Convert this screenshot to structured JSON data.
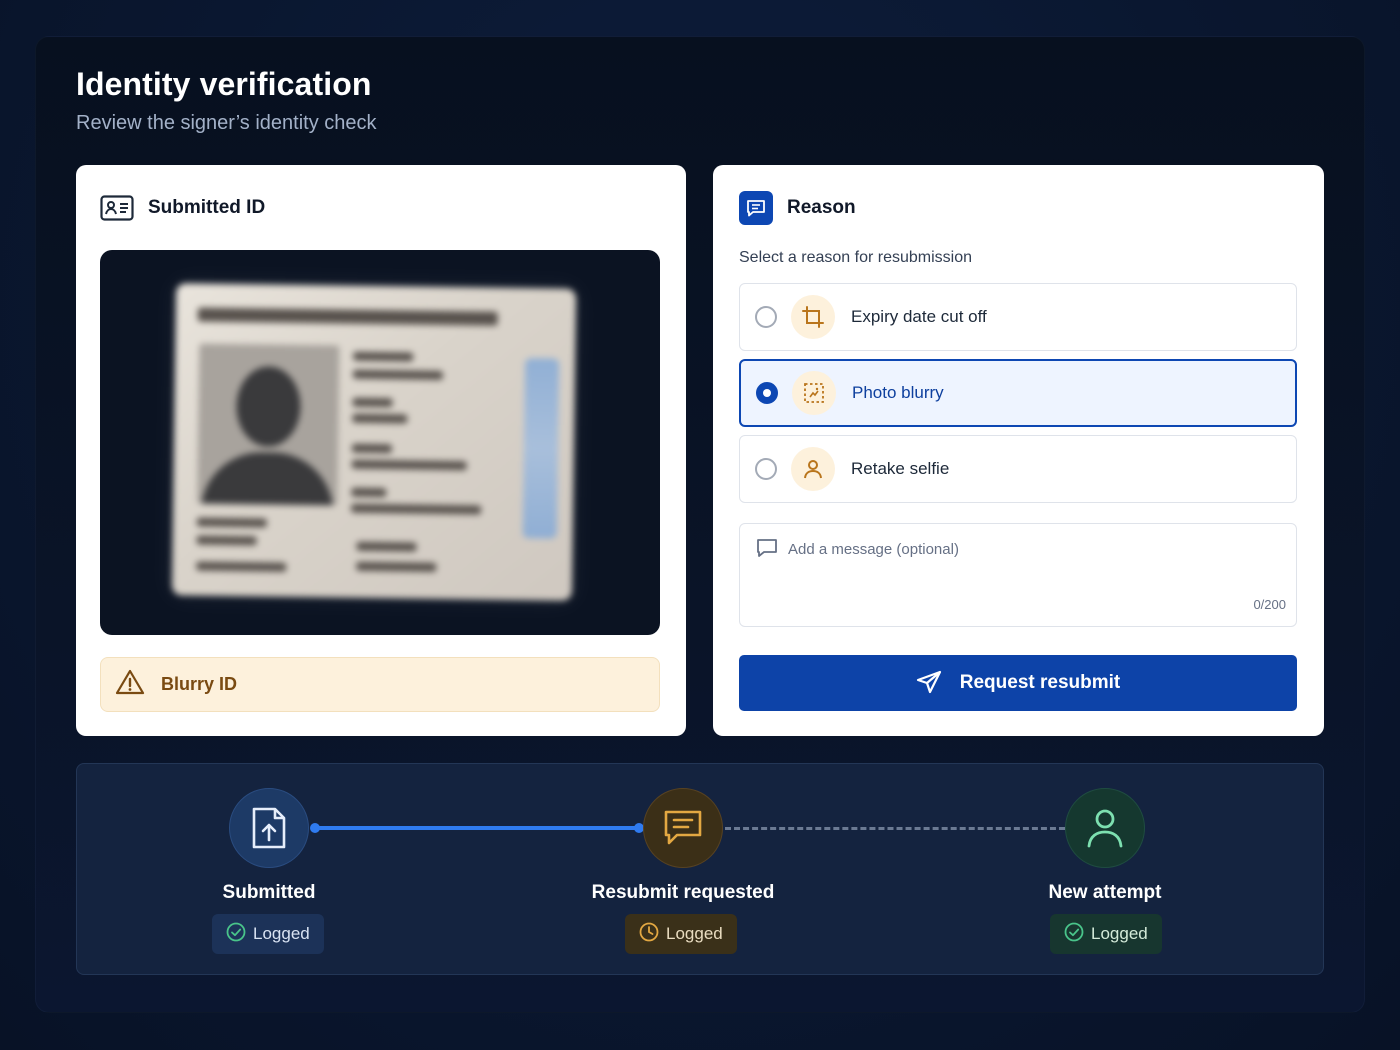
{
  "header": {
    "title": "Identity verification",
    "subtitle": "Review the signer’s identity check"
  },
  "submitted_id": {
    "title": "Submitted ID",
    "warning": "Blurry ID"
  },
  "reason": {
    "title": "Reason",
    "prompt": "Select a reason for resubmission",
    "options": [
      {
        "label": "Expiry date cut off",
        "icon": "crop-icon",
        "selected": false
      },
      {
        "label": "Photo blurry",
        "icon": "focus-icon",
        "selected": true
      },
      {
        "label": "Retake selfie",
        "icon": "person-icon",
        "selected": false
      }
    ],
    "message_placeholder": "Add a message (optional)",
    "message_counter": "0/200",
    "submit_label": "Request resubmit"
  },
  "timeline": {
    "steps": [
      {
        "label": "Submitted",
        "status": "Logged",
        "icon": "upload-file-icon",
        "color": "#2f7bf0"
      },
      {
        "label": "Resubmit requested",
        "status": "Logged",
        "icon": "message-icon",
        "color": "#e3a842"
      },
      {
        "label": "New attempt",
        "status": "Logged",
        "icon": "user-icon",
        "color": "#49c48a"
      }
    ]
  },
  "colors": {
    "primary": "#0d43a8",
    "warning_bg": "#fdf1dc",
    "success": "#49c48a",
    "pending": "#e3a842"
  }
}
